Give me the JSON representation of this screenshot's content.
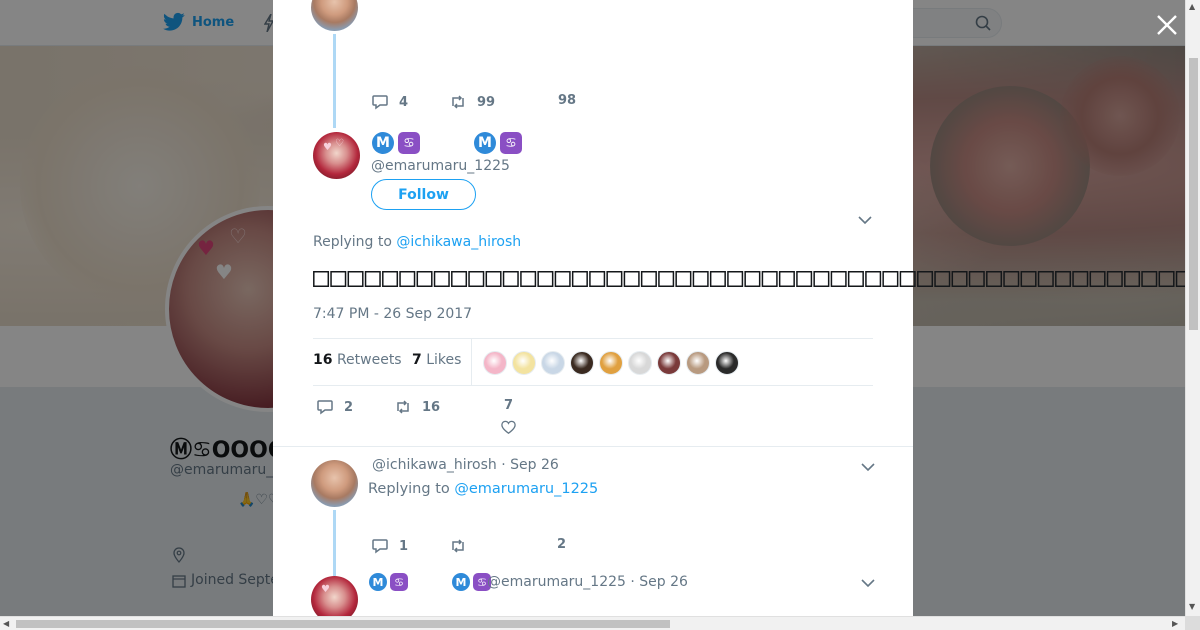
{
  "nav": {
    "home_label": "Home"
  },
  "profile": {
    "display_name": "Ⓜ♋ΟΟΟΟ",
    "handle": "@emarumaru_",
    "bio_emoji": "🙏♡♡",
    "joined": "Joined Septe"
  },
  "modal": {
    "top_tweet": {
      "reply_count": "4",
      "retweet_count": "99",
      "like_count": "98"
    },
    "main_tweet": {
      "name_badges": [
        "M",
        "♋",
        "M",
        "♋"
      ],
      "handle": "@emarumaru_1225",
      "follow_label": "Follow",
      "replying_prefix": "Replying to ",
      "replying_to": "@ichikawa_hirosh",
      "text": "□□□□□□□□□□□□□□□□□□□□□□□□□□□□□□□□□□□□□□□□□□□□□□□□□□□□□□□□□",
      "timestamp": "7:47 PM - 26 Sep 2017",
      "retweets_count": "16",
      "retweets_label": "Retweets",
      "likes_count": "7",
      "likes_label": "Likes",
      "reply_count": "2",
      "retweet_count": "16",
      "like_count": "7",
      "likers": [
        "#f4b6c8",
        "#f3e3a0",
        "#c9d7e6",
        "#3a2a20",
        "#e0a040",
        "#d8d8d8",
        "#7a3a3a",
        "#b89a80",
        "#2a2a2a"
      ]
    },
    "reply1": {
      "handle": "@ichikawa_hirosh",
      "date": "· Sep 26",
      "replying_prefix": "Replying to ",
      "replying_to": "@emarumaru_1225",
      "reply_count": "1",
      "retweet_count": "",
      "like_count": "2"
    },
    "reply2": {
      "handle": "@emarumaru_1225",
      "date": "· Sep 26"
    }
  },
  "colors": {
    "accent": "#1da1f2",
    "thread_line": "#aed8f5",
    "muted": "#657786"
  }
}
